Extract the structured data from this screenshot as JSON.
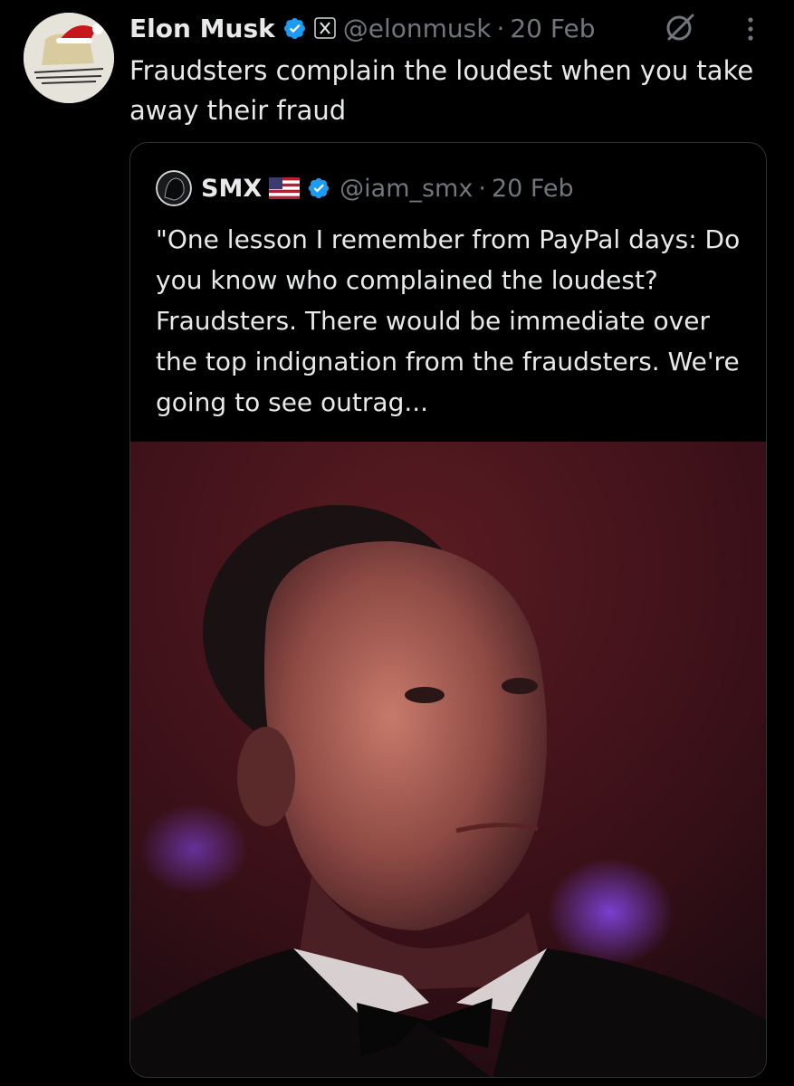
{
  "tweet": {
    "author_name": "Elon Musk",
    "handle": "@elonmusk",
    "separator": "·",
    "date": "20 Feb",
    "text": "Fraudsters complain the loudest when you take away their fraud",
    "verified_color": "#1d9bf0",
    "icons": [
      "verified-badge-icon",
      "x-affiliate-badge-icon",
      "grok-icon",
      "more-options-icon"
    ]
  },
  "quoted_tweet": {
    "author_name": "SMX",
    "handle": "@iam_smx",
    "separator": "·",
    "date": "20 Feb",
    "text": "\"One lesson I remember from PayPal days: Do you know who complained the loudest? Fraudsters. There would be immediate over the top indignation from the fraudsters. We're going to see outrag...",
    "icons": [
      "us-flag-icon",
      "verified-badge-icon"
    ]
  },
  "colors": {
    "background": "#000000",
    "text_primary": "#e7e9ea",
    "text_secondary": "#71767b",
    "border": "#2f3336"
  }
}
